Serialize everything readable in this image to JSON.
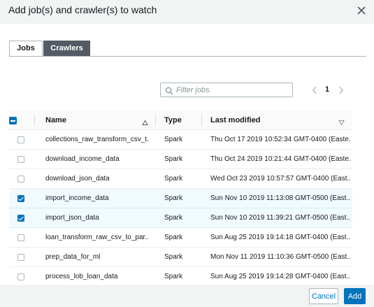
{
  "dialog": {
    "title": "Add job(s) and crawler(s) to watch"
  },
  "tabs": [
    {
      "label": "Jobs",
      "active": true
    },
    {
      "label": "Crawlers",
      "active": false
    }
  ],
  "search": {
    "placeholder": "Filter jobs",
    "value": ""
  },
  "pagination": {
    "page": "1"
  },
  "table": {
    "columns": [
      "Name",
      "Type",
      "Last modified"
    ],
    "rows": [
      {
        "selected": false,
        "name": "collections_raw_transform_csv_t...",
        "type": "Spark",
        "modified": "Thu Oct 17 2019 10:52:34 GMT-0400 (Easte..."
      },
      {
        "selected": false,
        "name": "download_income_data",
        "type": "Spark",
        "modified": "Thu Oct 24 2019 10:21:44 GMT-0400 (Easte..."
      },
      {
        "selected": false,
        "name": "download_json_data",
        "type": "Spark",
        "modified": "Wed Oct 23 2019 10:57:57 GMT-0400 (East..."
      },
      {
        "selected": true,
        "name": "import_income_data",
        "type": "Spark",
        "modified": "Sun Nov 10 2019 11:13:08 GMT-0500 (East..."
      },
      {
        "selected": true,
        "name": "import_json_data",
        "type": "Spark",
        "modified": "Sun Nov 10 2019 11:39:21 GMT-0500 (East..."
      },
      {
        "selected": false,
        "name": "loan_transform_raw_csv_to_par...",
        "type": "Spark",
        "modified": "Sun Aug 25 2019 19:14:18 GMT-0400 (East..."
      },
      {
        "selected": false,
        "name": "prep_data_for_ml",
        "type": "Spark",
        "modified": "Mon Nov 11 2019 11:10:36 GMT-0500 (East..."
      },
      {
        "selected": false,
        "name": "process_lob_loan_data",
        "type": "Spark",
        "modified": "Sun Aug 25 2019 19:14:28 GMT-0400 (East..."
      }
    ]
  },
  "footer": {
    "cancel_label": "Cancel",
    "add_label": "Add"
  },
  "colors": {
    "accent": "#0073bb",
    "header_bg": "#f2f3f3",
    "selected_row": "#f1faff",
    "tab_inactive": "#545b64"
  },
  "icons": {
    "close": "close-icon",
    "search": "search-icon",
    "prev": "chevron-left-icon",
    "next": "chevron-right-icon",
    "sort_asc": "sort-ascending-icon",
    "sort": "sort-descending-icon"
  }
}
